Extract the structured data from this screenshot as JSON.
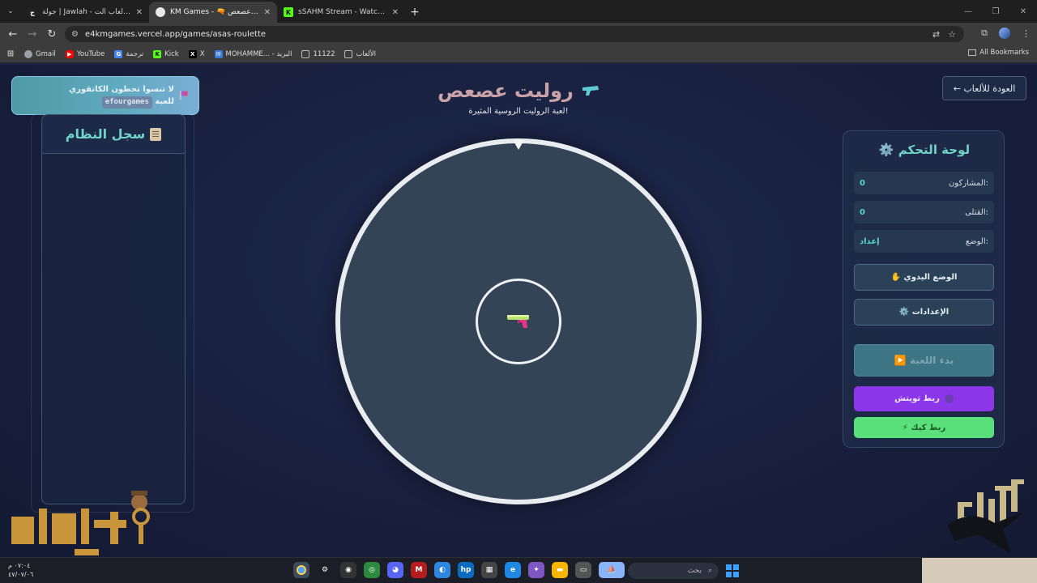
{
  "browser": {
    "tabs": [
      {
        "title": "جولة | Jawlah - منصة الألعاب الت...",
        "favicon": "jawlah",
        "active": false
      },
      {
        "title": "KM Games - 🔫 روليت عصعص",
        "favicon": "e4km",
        "active": true
      },
      {
        "title": "sSAHM Stream - Watch Live on...",
        "favicon": "kick",
        "active": false
      }
    ],
    "new_tab": "+",
    "url": "e4kmgames.vercel.app/games/asas-roulette",
    "bookmarks": [
      {
        "label": "Gmail",
        "icon": "globe-icon"
      },
      {
        "label": "YouTube",
        "icon": "youtube-icon"
      },
      {
        "label": "ترجمة",
        "icon": "translate-icon"
      },
      {
        "label": "Kick",
        "icon": "kick-icon"
      },
      {
        "label": "X",
        "icon": "x-icon"
      },
      {
        "label": "MOHAMME... - البريد",
        "icon": "mail-icon"
      },
      {
        "label": "11122",
        "icon": "folder-icon"
      },
      {
        "label": "الألعاب",
        "icon": "folder-icon"
      }
    ],
    "all_bookmarks": "All Bookmarks"
  },
  "page": {
    "reminder": {
      "line1": "لا تنسوا تحطون الكاتقوري",
      "code": "efourgames",
      "line2": "للعبة"
    },
    "system_log": {
      "title": "سجل النظام"
    },
    "title": "روليت عصعص",
    "subtitle": "لعبة الروليت الروسية المثيرة!",
    "back_button": "← العودة للألعاب",
    "control_panel": {
      "title": "⚙️ لوحة التحكم",
      "stats": [
        {
          "label": "المشاركون:",
          "value": "0"
        },
        {
          "label": "القتلى:",
          "value": "0"
        },
        {
          "label": "الوضع:",
          "value": "إعداد"
        }
      ],
      "manual_mode": "✋ الوضع اليدوي",
      "settings": "⚙️ الإعدادات",
      "start": "▶️ بدء اللعبة",
      "twitch": "ربط تويتش",
      "kick": "⚡ ربط كيك"
    },
    "colors": {
      "accent": "#6fd3c7",
      "twitch": "#8c36ea",
      "kick": "#5ae07a",
      "wheel": "#334457"
    }
  },
  "taskbar": {
    "time": "٠٧:٠٤ م",
    "date": "٤٧/٠٧/٠٦",
    "search_placeholder": "بحث"
  }
}
